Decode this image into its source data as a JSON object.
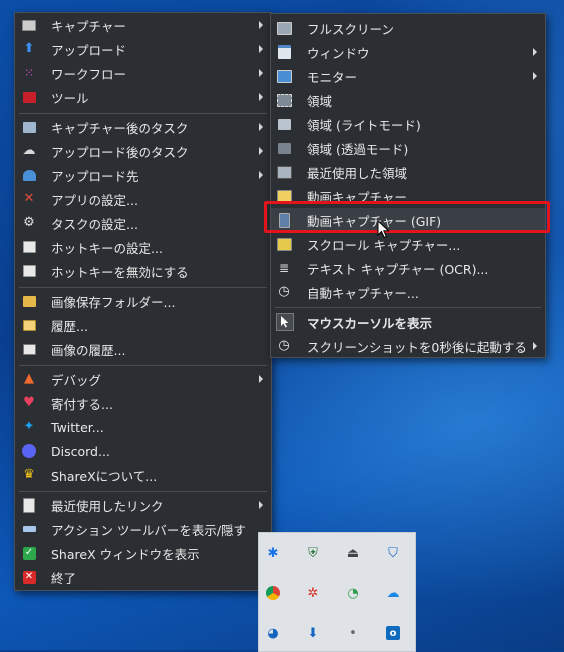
{
  "colors": {
    "menu_bg": "#2b2f33",
    "highlight": "#e3141b",
    "text": "#e8e8e8"
  },
  "main_menu": [
    {
      "label": "キャプチャー",
      "icon": "capture-icon",
      "submenu": true
    },
    {
      "label": "アップロード",
      "icon": "upload-arrow-icon",
      "submenu": true
    },
    {
      "label": "ワークフロー",
      "icon": "workflow-grid-icon",
      "submenu": true
    },
    {
      "label": "ツール",
      "icon": "toolbox-icon",
      "submenu": true
    },
    {
      "label": "キャプチャー後のタスク",
      "icon": "after-capture-icon",
      "submenu": true
    },
    {
      "label": "アップロード後のタスク",
      "icon": "cloud-upload-icon",
      "submenu": true
    },
    {
      "label": "アップロード先",
      "icon": "upload-destination-icon",
      "submenu": true
    },
    {
      "label": "アプリの設定...",
      "icon": "wrench-icon",
      "submenu": false
    },
    {
      "label": "タスクの設定...",
      "icon": "gear-icon",
      "submenu": false
    },
    {
      "label": "ホットキーの設定...",
      "icon": "keyboard-icon",
      "submenu": false
    },
    {
      "label": "ホットキーを無効にする",
      "icon": "keyboard-disable-icon",
      "submenu": false
    },
    {
      "label": "画像保存フォルダー...",
      "icon": "folder-icon",
      "submenu": false
    },
    {
      "label": "履歴...",
      "icon": "history-icon",
      "submenu": false
    },
    {
      "label": "画像の履歴...",
      "icon": "image-history-icon",
      "submenu": false
    },
    {
      "label": "デバッグ",
      "icon": "bug-cone-icon",
      "submenu": true
    },
    {
      "label": "寄付する...",
      "icon": "heart-icon",
      "submenu": false
    },
    {
      "label": "Twitter...",
      "icon": "twitter-icon",
      "submenu": false
    },
    {
      "label": "Discord...",
      "icon": "discord-icon",
      "submenu": false
    },
    {
      "label": "ShareXについて...",
      "icon": "crown-icon",
      "submenu": false
    },
    {
      "label": "最近使用したリンク",
      "icon": "clipboard-icon",
      "submenu": true
    },
    {
      "label": "アクション ツールバーを表示/隠す",
      "icon": "toolbar-icon",
      "submenu": false
    },
    {
      "label": "ShareX ウィンドウを表示",
      "icon": "check-icon",
      "submenu": false
    },
    {
      "label": "終了",
      "icon": "exit-icon",
      "submenu": false
    }
  ],
  "capture_submenu": [
    {
      "label": "フルスクリーン",
      "icon": "fullscreen-icon",
      "submenu": false
    },
    {
      "label": "ウィンドウ",
      "icon": "window-icon",
      "submenu": true
    },
    {
      "label": "モニター",
      "icon": "monitor-icon",
      "submenu": true
    },
    {
      "label": "領域",
      "icon": "region-icon",
      "submenu": false
    },
    {
      "label": "領域 (ライトモード)",
      "icon": "region-light-icon",
      "submenu": false
    },
    {
      "label": "領域 (透過モード)",
      "icon": "region-transparent-icon",
      "submenu": false
    },
    {
      "label": "最近使用した領域",
      "icon": "last-region-icon",
      "submenu": false
    },
    {
      "label": "動画キャプチャー",
      "icon": "video-capture-icon",
      "submenu": false
    },
    {
      "label": "動画キャプチャー (GIF)",
      "icon": "gif-capture-icon",
      "submenu": false
    },
    {
      "label": "スクロール キャプチャー...",
      "icon": "scroll-capture-icon",
      "submenu": false
    },
    {
      "label": "テキスト キャプチャー (OCR)...",
      "icon": "ocr-icon",
      "submenu": false
    },
    {
      "label": "自動キャプチャー...",
      "icon": "clock-icon",
      "submenu": false
    },
    {
      "label": "マウスカーソルを表示",
      "icon": "cursor-icon",
      "submenu": false
    },
    {
      "label": "スクリーンショットを0秒後に起動する",
      "icon": "timer-icon",
      "submenu": true
    }
  ]
}
